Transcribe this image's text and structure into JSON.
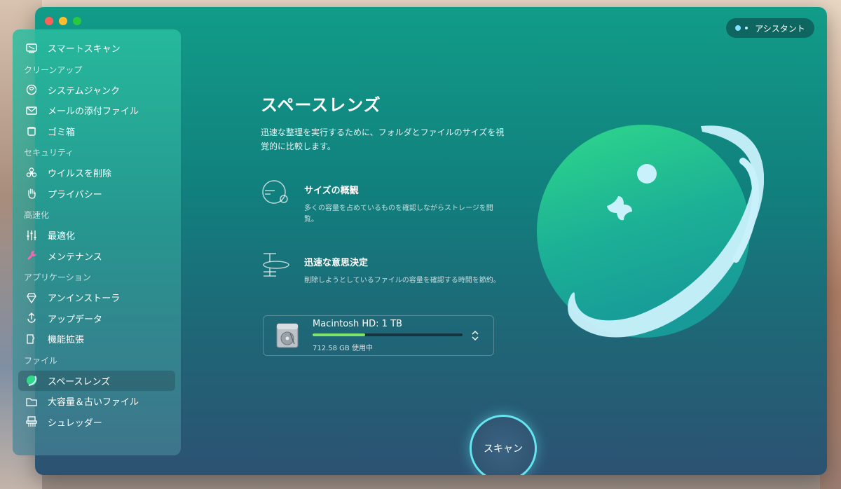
{
  "window": {
    "assistant_label": "アシスタント"
  },
  "sidebar": {
    "items": [
      {
        "type": "item",
        "label": "スマートスキャン",
        "icon": "smart-scan-icon"
      },
      {
        "type": "section",
        "label": "クリーンアップ"
      },
      {
        "type": "item",
        "label": "システムジャンク",
        "icon": "system-junk-icon"
      },
      {
        "type": "item",
        "label": "メールの添付ファイル",
        "icon": "mail-icon"
      },
      {
        "type": "item",
        "label": "ゴミ箱",
        "icon": "trash-icon"
      },
      {
        "type": "section",
        "label": "セキュリティ"
      },
      {
        "type": "item",
        "label": "ウイルスを削除",
        "icon": "biohazard-icon"
      },
      {
        "type": "item",
        "label": "プライバシー",
        "icon": "hand-icon"
      },
      {
        "type": "section",
        "label": "高速化"
      },
      {
        "type": "item",
        "label": "最適化",
        "icon": "sliders-icon"
      },
      {
        "type": "item",
        "label": "メンテナンス",
        "icon": "wrench-icon"
      },
      {
        "type": "section",
        "label": "アプリケーション"
      },
      {
        "type": "item",
        "label": "アンインストーラ",
        "icon": "uninstaller-icon"
      },
      {
        "type": "item",
        "label": "アップデータ",
        "icon": "updater-icon"
      },
      {
        "type": "item",
        "label": "機能拡張",
        "icon": "extensions-icon"
      },
      {
        "type": "section",
        "label": "ファイル"
      },
      {
        "type": "item",
        "label": "スペースレンズ",
        "icon": "space-lens-icon",
        "active": true
      },
      {
        "type": "item",
        "label": "大容量＆古いファイル",
        "icon": "folder-icon"
      },
      {
        "type": "item",
        "label": "シュレッダー",
        "icon": "shredder-icon"
      }
    ]
  },
  "main": {
    "title": "スペースレンズ",
    "description": "迅速な整理を実行するために、フォルダとファイルのサイズを視覚的に比較します。",
    "features": [
      {
        "title": "サイズの概観",
        "description": "多くの容量を占めているものを確認しながらストレージを閲覧。",
        "icon": "size-overview-icon"
      },
      {
        "title": "迅速な意思決定",
        "description": "削除しようとしているファイルの容量を確認する時間を節約。",
        "icon": "quick-decision-icon"
      }
    ],
    "disk": {
      "name": "Macintosh HD: 1 TB",
      "used": "712.58 GB 使用中",
      "used_fraction": 0.35,
      "icon": "hard-drive-icon"
    },
    "scan_label": "スキャン"
  },
  "colors": {
    "accent": "#64e6f0",
    "progress": "#7ee36a",
    "window_top": "#119c88",
    "window_bottom": "#2c5272"
  }
}
